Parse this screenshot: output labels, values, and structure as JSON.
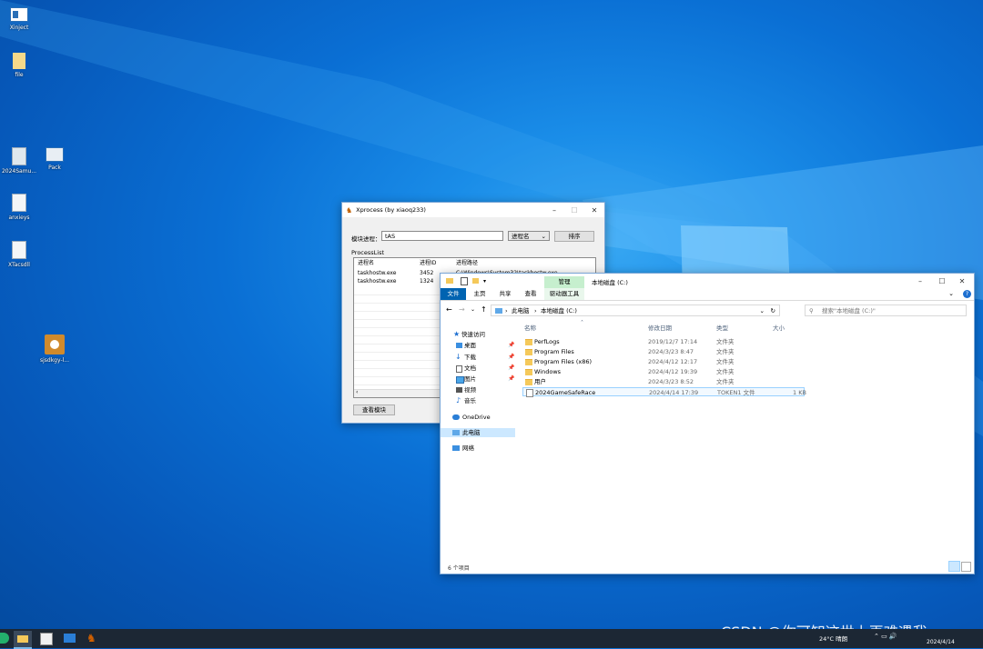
{
  "desktop": {
    "icons": [
      {
        "label": "Xinject",
        "icon": "window-app-icon"
      },
      {
        "label": "file",
        "icon": "file-icon"
      },
      {
        "label": "2024Samu...",
        "icon": "document-icon"
      },
      {
        "label": "Pack",
        "icon": "pc-icon"
      },
      {
        "label": "anxieys",
        "icon": "config-file-icon"
      },
      {
        "label": "XTacsdll",
        "icon": "config-file-icon"
      },
      {
        "label": "sjsdkgy-l...",
        "icon": "installer-icon"
      }
    ]
  },
  "xprocess": {
    "title": "Xprocess (by xiaoq233)",
    "search_label": "模块进程：",
    "search_value": "tAS",
    "mode_select": "进程名",
    "sort_button": "排序",
    "group_label": "ProcessList",
    "columns": [
      "进程名",
      "进程ID",
      "进程路径"
    ],
    "rows": [
      {
        "name": "taskhostw.exe",
        "pid": "3452",
        "path": "C:\\Windows\\System32\\taskhostw.exe"
      },
      {
        "name": "taskhostw.exe",
        "pid": "1324",
        "path": ""
      }
    ],
    "view_modules_button": "查看模块"
  },
  "explorer": {
    "title": "本地磁盘 (C:)",
    "qat_arrow": "▾",
    "ribbon_tabs": [
      "文件",
      "主页",
      "共享",
      "查看"
    ],
    "context_tab_group": "管理",
    "context_tab": "驱动器工具",
    "breadcrumb": [
      "此电脑",
      "本地磁盘 (C:)"
    ],
    "search_placeholder": "搜索\"本地磁盘 (C:)\"",
    "nav": [
      {
        "label": "快速访问",
        "icon": "star-icon",
        "pinned": false
      },
      {
        "label": "桌面",
        "icon": "desktop-icon",
        "pinned": true
      },
      {
        "label": "下载",
        "icon": "download-icon",
        "pinned": true
      },
      {
        "label": "文档",
        "icon": "document-icon",
        "pinned": true
      },
      {
        "label": "图片",
        "icon": "picture-icon",
        "pinned": true
      },
      {
        "label": "视频",
        "icon": "video-icon",
        "pinned": false
      },
      {
        "label": "音乐",
        "icon": "music-icon",
        "pinned": false
      },
      {
        "label": "OneDrive",
        "icon": "cloud-icon",
        "pinned": false
      },
      {
        "label": "此电脑",
        "icon": "pc-icon",
        "pinned": false
      },
      {
        "label": "网络",
        "icon": "network-icon",
        "pinned": false
      }
    ],
    "columns": [
      "名称",
      "修改日期",
      "类型",
      "大小"
    ],
    "files": [
      {
        "name": "PerfLogs",
        "date": "2019/12/7 17:14",
        "type": "文件夹",
        "size": "",
        "is_folder": true
      },
      {
        "name": "Program Files",
        "date": "2024/3/23 8:47",
        "type": "文件夹",
        "size": "",
        "is_folder": true
      },
      {
        "name": "Program Files (x86)",
        "date": "2024/4/12 12:17",
        "type": "文件夹",
        "size": "",
        "is_folder": true
      },
      {
        "name": "Windows",
        "date": "2024/4/12 19:39",
        "type": "文件夹",
        "size": "",
        "is_folder": true
      },
      {
        "name": "用户",
        "date": "2024/3/23 8:52",
        "type": "文件夹",
        "size": "",
        "is_folder": true
      },
      {
        "name": "2024GameSafeRace",
        "date": "2024/4/14 17:39",
        "type": "TOKEN1 文件",
        "size": "1 KB",
        "is_folder": false
      }
    ],
    "status": "6 个项目"
  },
  "taskbar": {
    "weather": "24°C 晴朗",
    "date": "2024/4/14"
  },
  "watermark": "CSDN @你可知这世上再难遇我",
  "colors": {
    "accent": "#0063b1",
    "context_tab": "#c6efce",
    "selected": "#cce8ff",
    "taskbar": "#1c2734"
  }
}
